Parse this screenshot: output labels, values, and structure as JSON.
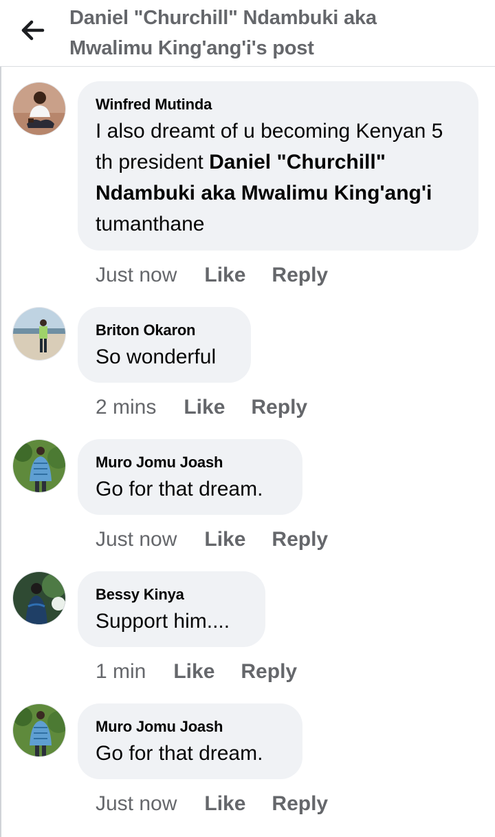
{
  "header": {
    "title": "Daniel \"Churchill\" Ndambuki aka Mwalimu King'ang'i's post",
    "back_icon": "arrow-left-icon"
  },
  "comments": [
    {
      "author": "Winfred Mutinda",
      "text_before": "I also dreamt of u becoming Kenyan 5 th president ",
      "mention": "Daniel \"Churchill\" Ndambuki aka Mwalimu King'ang'i",
      "text_after": " tumanthane",
      "time": "Just now",
      "like": "Like",
      "reply": "Reply"
    },
    {
      "author": "Briton Okaron",
      "text": "So wonderful",
      "time": "2 mins",
      "like": "Like",
      "reply": "Reply"
    },
    {
      "author": "Muro Jomu Joash",
      "text": "Go for that dream.",
      "time": "Just now",
      "like": "Like",
      "reply": "Reply"
    },
    {
      "author": "Bessy Kinya",
      "text": "Support him....",
      "time": "1 min",
      "like": "Like",
      "reply": "Reply"
    },
    {
      "author": "Muro Jomu Joash",
      "text": "Go for that dream.",
      "time": "Just now",
      "like": "Like",
      "reply": "Reply"
    }
  ],
  "colors": {
    "bubble": "#f0f2f5",
    "secondary_text": "#65676b",
    "primary_text": "#050505"
  }
}
